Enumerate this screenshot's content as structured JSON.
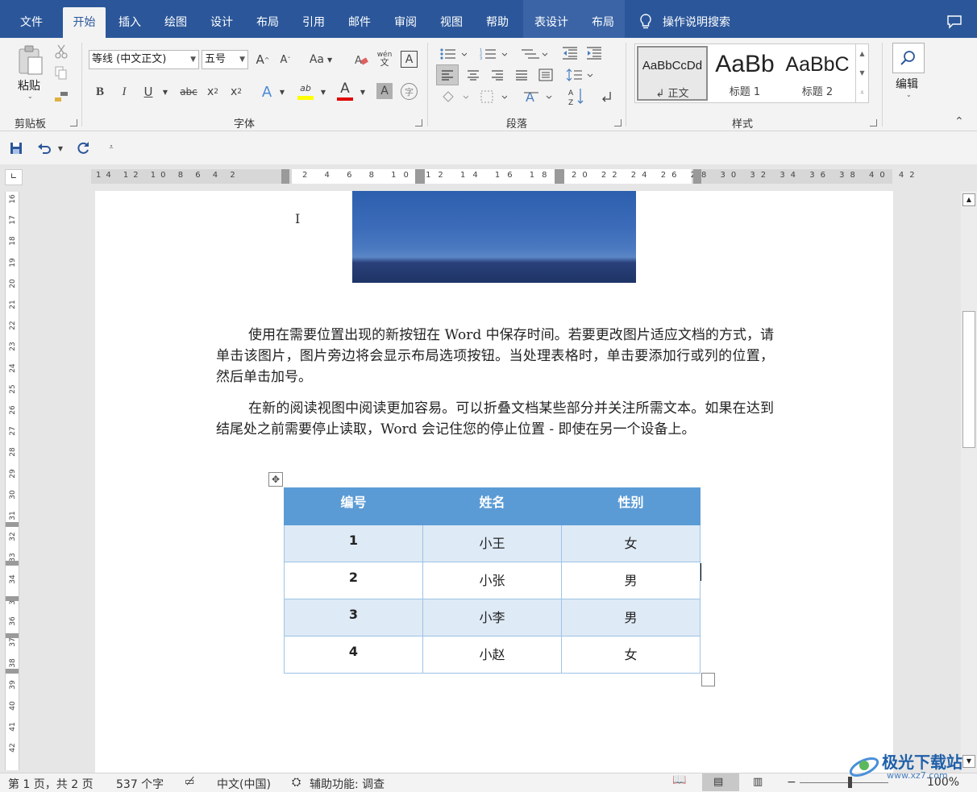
{
  "tabs": {
    "file": "文件",
    "home": "开始",
    "insert": "插入",
    "draw": "绘图",
    "design": "设计",
    "layout": "布局",
    "references": "引用",
    "mailings": "邮件",
    "review": "审阅",
    "view": "视图",
    "help": "帮助",
    "table_design": "表设计",
    "table_layout": "布局",
    "tell_me": "操作说明搜索"
  },
  "ribbon": {
    "clipboard": {
      "paste": "粘贴",
      "label": "剪贴板"
    },
    "font": {
      "font_name": "等线 (中文正文)",
      "font_size": "五号",
      "grow": "A",
      "shrink": "A",
      "change_case": "Aa",
      "phonetic": "wén",
      "char_border": "A",
      "bold": "B",
      "italic": "I",
      "underline": "U",
      "strike": "abc",
      "subscript": "x",
      "superscript": "x",
      "text_effects": "A",
      "highlight": "ab",
      "font_color": "A",
      "shading": "A",
      "enclose": "字",
      "label": "字体"
    },
    "paragraph": {
      "label": "段落"
    },
    "styles": {
      "items": [
        {
          "preview": "AaBbCcDd",
          "name": "正文",
          "mark": "↲"
        },
        {
          "preview": "AaBb",
          "name": "标题 1"
        },
        {
          "preview": "AaBbC",
          "name": "标题 2"
        }
      ],
      "label": "样式"
    },
    "editing": {
      "label": "编辑"
    }
  },
  "document": {
    "para1": "使用在需要位置出现的新按钮在 Word 中保存时间。若要更改图片适应文档的方式，请单击该图片，图片旁边将会显示布局选项按钮。当处理表格时，单击要添加行或列的位置，然后单击加号。",
    "para2": "在新的阅读视图中阅读更加容易。可以折叠文档某些部分并关注所需文本。如果在达到结尾处之前需要停止读取，Word 会记住您的停止位置 - 即使在另一个设备上。",
    "table": {
      "headers": [
        "编号",
        "姓名",
        "性别"
      ],
      "rows": [
        [
          "1",
          "小王",
          "女"
        ],
        [
          "2",
          "小张",
          "男"
        ],
        [
          "3",
          "小李",
          "男"
        ],
        [
          "4",
          "小赵",
          "女"
        ]
      ]
    }
  },
  "ruler": {
    "h_left": "14 12 10 8 6 4 2",
    "h_mid": "2 4 6 8 10 12 14 16 18",
    "h_right": "20 22 24 26 28 30 32 34 36 38 40 42",
    "v": [
      "16",
      "17",
      "18",
      "19",
      "20",
      "21",
      "22",
      "23",
      "24",
      "25",
      "26",
      "27",
      "28",
      "29",
      "30",
      "31",
      "32",
      "33",
      "34",
      "35",
      "36",
      "37",
      "38",
      "39",
      "40",
      "41",
      "42"
    ]
  },
  "status": {
    "page": "第 1 页，共 2 页",
    "words": "537 个字",
    "language": "中文(中国)",
    "accessibility": "辅助功能: 调查",
    "zoom": "100%"
  },
  "watermark": {
    "text": "极光下载站",
    "url": "www.xz7.com"
  }
}
